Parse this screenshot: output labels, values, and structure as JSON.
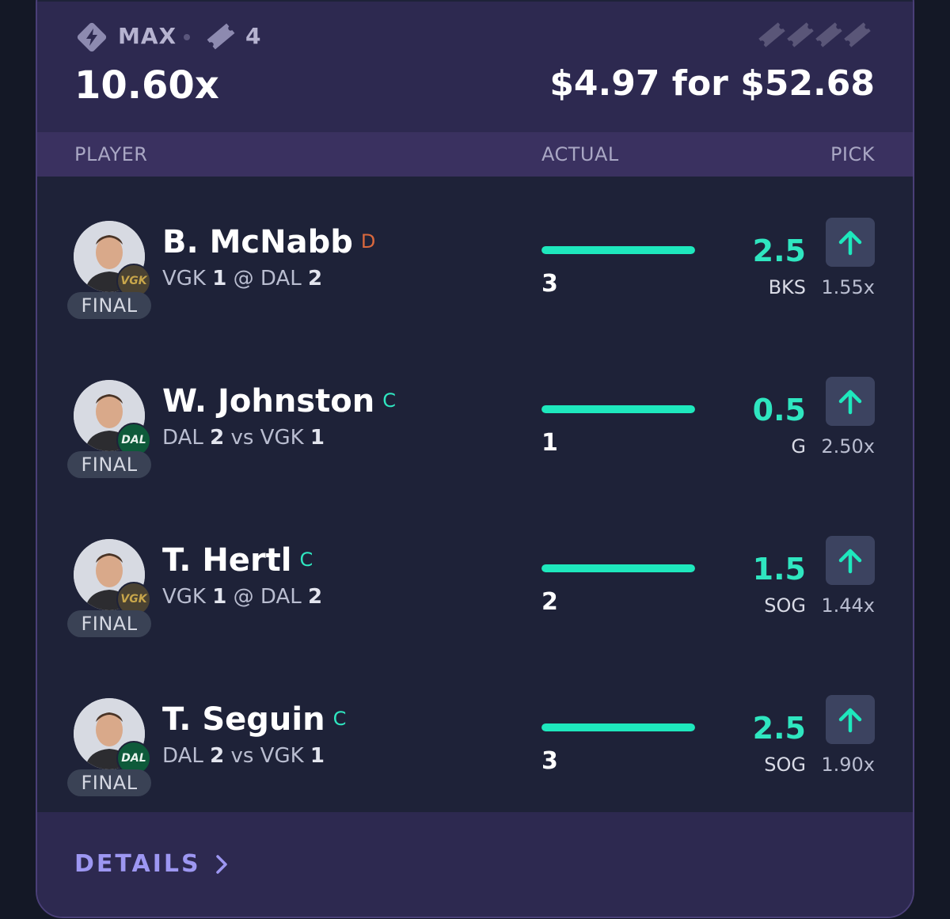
{
  "header": {
    "type_label": "MAX",
    "entries_count": "4",
    "multiplier": "10.60x",
    "payout": "$4.97 for $52.68",
    "icons": [
      "lightning-gem-icon",
      "ticket-icon"
    ]
  },
  "columns": {
    "player": "PLAYER",
    "actual": "ACTUAL",
    "pick": "PICK"
  },
  "players": [
    {
      "name": "B. McNabb",
      "position": "D",
      "team": "VGK",
      "status": "FINAL",
      "game": {
        "team1": "VGK",
        "score1": "1",
        "sep": "@",
        "team2": "DAL",
        "score2": "2"
      },
      "actual": "3",
      "line": "2.5",
      "stat": "BKS",
      "payout": "1.55x",
      "progress": 1.0
    },
    {
      "name": "W. Johnston",
      "position": "C",
      "team": "DAL",
      "status": "FINAL",
      "game": {
        "team1": "DAL",
        "score1": "2",
        "sep": "vs",
        "team2": "VGK",
        "score2": "1"
      },
      "actual": "1",
      "line": "0.5",
      "stat": "G",
      "payout": "2.50x",
      "progress": 1.0
    },
    {
      "name": "T. Hertl",
      "position": "C",
      "team": "VGK",
      "status": "FINAL",
      "game": {
        "team1": "VGK",
        "score1": "1",
        "sep": "@",
        "team2": "DAL",
        "score2": "2"
      },
      "actual": "2",
      "line": "1.5",
      "stat": "SOG",
      "payout": "1.44x",
      "progress": 1.0
    },
    {
      "name": "T. Seguin",
      "position": "C",
      "team": "DAL",
      "status": "FINAL",
      "game": {
        "team1": "DAL",
        "score1": "2",
        "sep": "vs",
        "team2": "VGK",
        "score2": "1"
      },
      "actual": "3",
      "line": "2.5",
      "stat": "SOG",
      "payout": "1.90x",
      "progress": 1.0
    }
  ],
  "footer": {
    "details_label": "DETAILS"
  },
  "colors": {
    "accent": "#1ee8bd",
    "header_bg": "#2d2950",
    "card_bg": "#1e2238"
  }
}
